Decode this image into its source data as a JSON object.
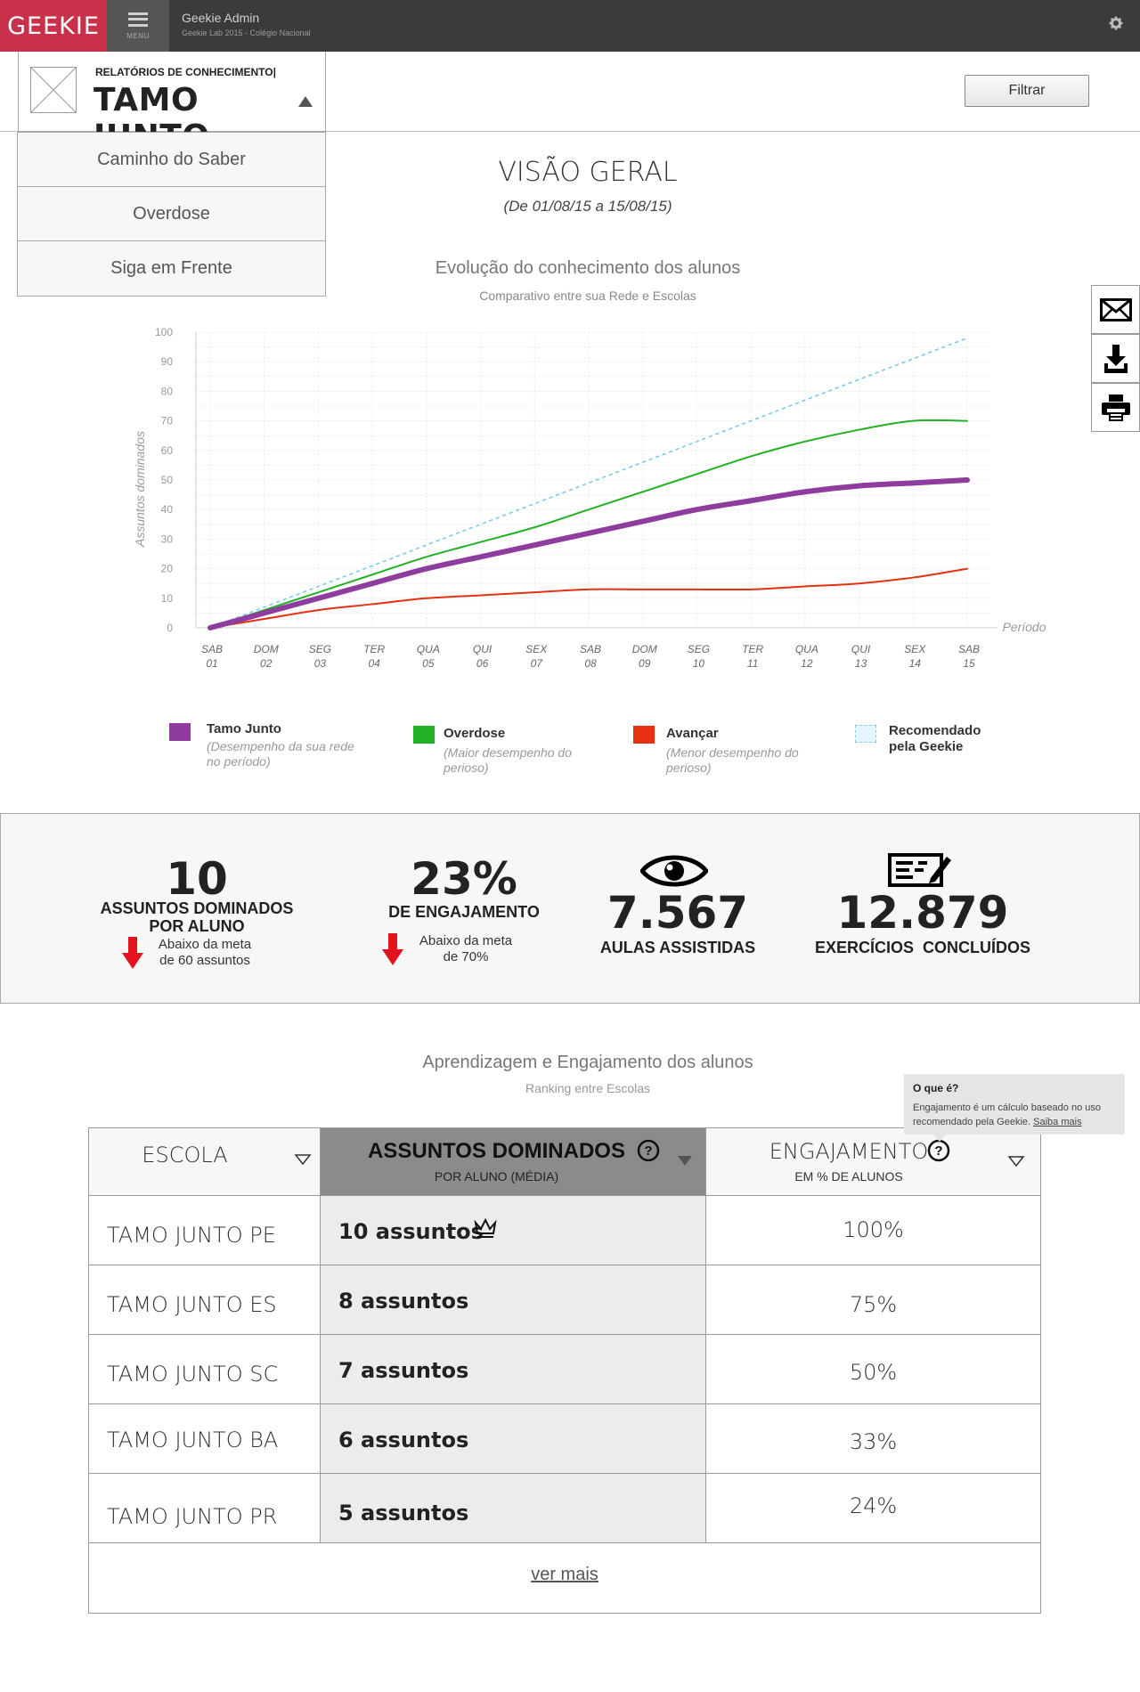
{
  "topbar": {
    "logo": "GEEKIE",
    "menu_label": "MENU",
    "admin_name": "Geekie Admin",
    "admin_sub": "Geekie Lab 2015 - Colégio Nacional"
  },
  "header": {
    "kicker": "RELATÓRIOS DE CONHECIMENTO|",
    "report_name": "TAMO JUNTO",
    "filter_label": "Filtrar"
  },
  "dropdown": [
    "Caminho do Saber",
    "Overdose",
    "Siga em Frente"
  ],
  "overview": {
    "title": "VISÃO GERAL",
    "period": "(De 01/08/15 a 15/08/15)"
  },
  "chart_data": {
    "type": "line",
    "title": "Evolução do conhecimento dos alunos",
    "subtitle": "Comparativo entre sua Rede e Escolas",
    "ylabel": "Assuntos dominados",
    "xlabel": "Período",
    "ylim": [
      0,
      100
    ],
    "yticks": [
      0,
      10,
      20,
      30,
      40,
      50,
      60,
      70,
      80,
      90,
      100
    ],
    "categories": [
      [
        "SAB",
        "01"
      ],
      [
        "DOM",
        "02"
      ],
      [
        "SEG",
        "03"
      ],
      [
        "TER",
        "04"
      ],
      [
        "QUA",
        "05"
      ],
      [
        "QUI",
        "06"
      ],
      [
        "SEX",
        "07"
      ],
      [
        "SAB",
        "08"
      ],
      [
        "DOM",
        "09"
      ],
      [
        "SEG",
        "10"
      ],
      [
        "TER",
        "11"
      ],
      [
        "QUA",
        "12"
      ],
      [
        "QUI",
        "13"
      ],
      [
        "SEX",
        "14"
      ],
      [
        "SAB",
        "15"
      ]
    ],
    "series": [
      {
        "name": "Tamo Junto",
        "color": "#8e3c9e",
        "width": 6,
        "dash": "",
        "values": [
          0,
          5,
          10,
          15,
          20,
          24,
          28,
          32,
          36,
          40,
          43,
          46,
          48,
          49,
          50
        ]
      },
      {
        "name": "Overdose",
        "color": "#22b024",
        "width": 2,
        "dash": "",
        "values": [
          0,
          6,
          12,
          18,
          24,
          29,
          34,
          40,
          46,
          52,
          58,
          63,
          67,
          70,
          70
        ]
      },
      {
        "name": "Avançar",
        "color": "#e53012",
        "width": 2,
        "dash": "",
        "values": [
          0,
          3,
          6,
          8,
          10,
          11,
          12,
          13,
          13,
          13,
          13,
          14,
          15,
          17,
          20
        ]
      },
      {
        "name": "Recomendado pela Geekie",
        "color": "#7fc8ea",
        "width": 1.6,
        "dash": "3,5",
        "values": [
          0,
          7,
          14,
          21,
          28,
          35,
          42,
          49,
          56,
          63,
          70,
          77,
          84,
          91,
          98
        ]
      }
    ]
  },
  "legend": [
    {
      "name": "Tamo Junto",
      "desc": "(Desempenho da sua rede no período)",
      "color": "#8e3c9e"
    },
    {
      "name": "Overdose",
      "desc": "(Maior desempenho do perioso)",
      "color": "#22b024"
    },
    {
      "name": "Avançar",
      "desc": "(Menor desempenho do perioso)",
      "color": "#e53012"
    },
    {
      "name": "Recomendado pela Geekie",
      "desc": "",
      "color": "#7fc8ea"
    }
  ],
  "kpis": {
    "assuntos": {
      "value": "10",
      "label1": "ASSUNTOS DOMINADOS",
      "label2": "POR ALUNO",
      "note1": "Abaixo da meta",
      "note2": "de 60 assuntos"
    },
    "engajamento": {
      "value": "23%",
      "label": "DE ENGAJAMENTO",
      "note1": "Abaixo da meta",
      "note2": "de 70%"
    },
    "aulas": {
      "value": "7.567",
      "label": "AULAS ASSISTIDAS"
    },
    "exercicios": {
      "value": "12.879",
      "label": "EXERCÍCIOS  CONCLUÍDOS"
    }
  },
  "ranking": {
    "title": "Aprendizagem e Engajamento dos alunos",
    "subtitle": "Ranking entre Escolas",
    "tooltip": {
      "head": "O que é?",
      "body": "Engajamento é um cálculo baseado no uso recomendado pela Geekie.",
      "link": "Saiba mais"
    },
    "columns": {
      "escola": "ESCOLA",
      "assuntos": "ASSUNTOS DOMINADOS",
      "assuntos_sub": "POR ALUNO (MÉDIA)",
      "engajamento": "ENGAJAMENTO",
      "engajamento_sub": "EM % DE ALUNOS"
    },
    "rows": [
      {
        "school": "TAMO JUNTO PE",
        "assuntos": "10 assuntos",
        "engaj": "100%"
      },
      {
        "school": "TAMO JUNTO ES",
        "assuntos": "8 assuntos",
        "engaj": "75%"
      },
      {
        "school": "TAMO JUNTO SC",
        "assuntos": "7 assuntos",
        "engaj": "50%"
      },
      {
        "school": "TAMO JUNTO BA",
        "assuntos": "6 assuntos",
        "engaj": "33%"
      },
      {
        "school": "TAMO JUNTO PR",
        "assuntos": "5 assuntos",
        "engaj": "24%"
      }
    ],
    "more": "ver mais"
  },
  "icons": {
    "side": [
      "envelope-icon",
      "download-icon",
      "print-icon"
    ],
    "kpi": [
      "arrow-down-icon",
      "eye-icon",
      "exercise-icon"
    ],
    "crown": "crown-icon",
    "help": "help-circle-icon"
  }
}
